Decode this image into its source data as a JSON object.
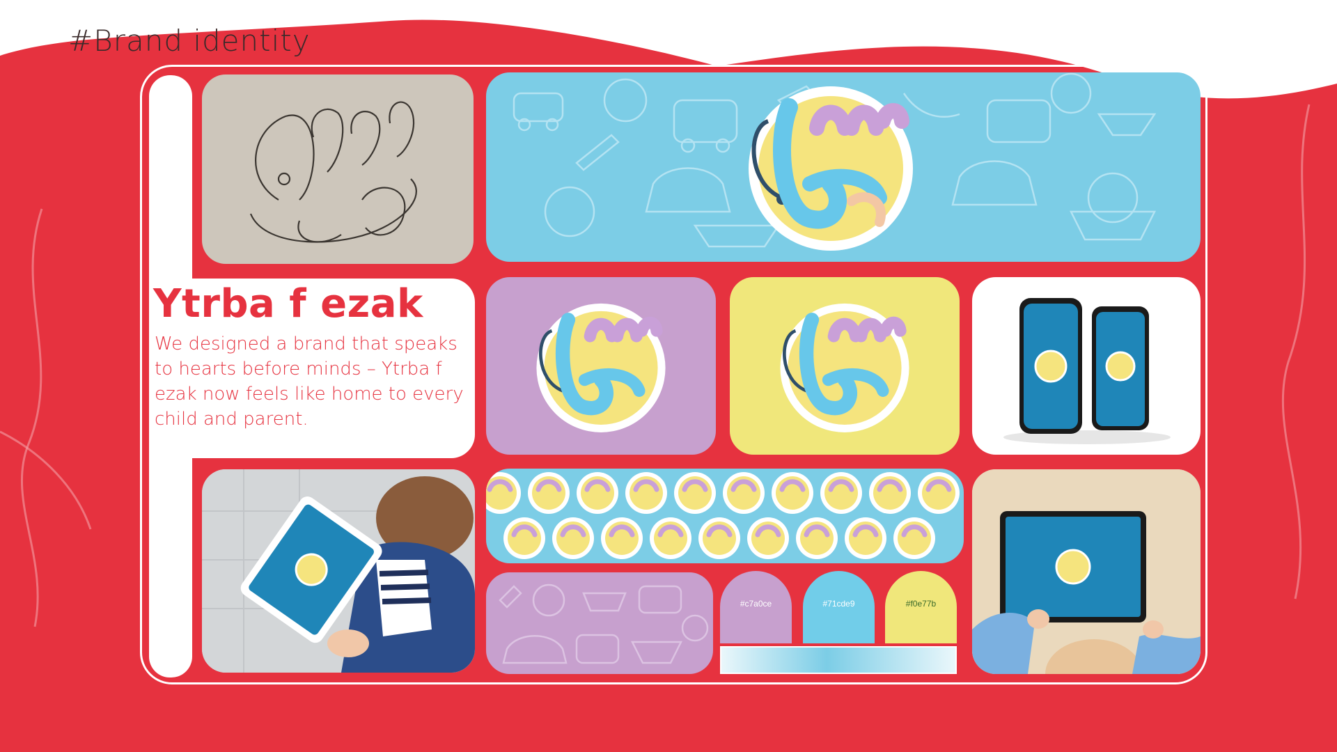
{
  "page": {
    "tag": "#Brand identity"
  },
  "brand": {
    "title": "Ytrba f ezak",
    "description": "We designed a brand that speaks to hearts before minds – Ytrba f ezak now feels like home to every child and parent."
  },
  "palette": {
    "swatches": [
      {
        "label": "#c7a0ce",
        "color": "#c7a0ce"
      },
      {
        "label": "#71cde9",
        "color": "#71cde9"
      },
      {
        "label": "#f0e77b",
        "color": "#f0e77b"
      }
    ]
  },
  "colors": {
    "background_red": "#e6323f",
    "sky_blue": "#7ccde6",
    "lilac": "#c7a0ce",
    "yellow": "#f0e77b",
    "white": "#ffffff"
  },
  "icons": [
    "stethoscope-logo-icon",
    "phone-mockup-icon",
    "tablet-mockup-icon"
  ]
}
